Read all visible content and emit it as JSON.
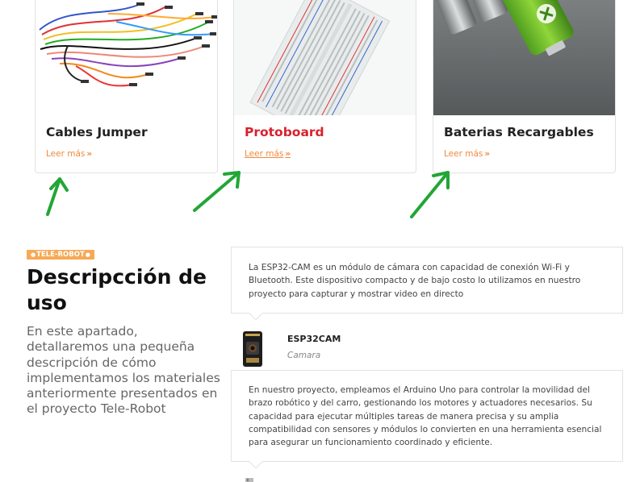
{
  "cards": [
    {
      "title": "Cables Jumper",
      "link": "Leer más",
      "chevron": "»",
      "image": "jumper-wires-image"
    },
    {
      "title": "Protoboard",
      "link": "Leer más",
      "chevron": "»",
      "image": "breadboard-image",
      "title_color": "#d8212d"
    },
    {
      "title": "Baterias Recargables",
      "link": "Leer más",
      "chevron": "»",
      "image": "rechargeable-batteries-image"
    }
  ],
  "annotations": {
    "arrow_color": "#22a636",
    "arrow_count": 3,
    "icon": "green-arrow-icon"
  },
  "section": {
    "badge": "TELE-ROBOT",
    "badge_color": "#f7a955",
    "title": "Descripcción de uso",
    "body": "En este apartado, detallaremos una pequeña descripción de cómo implementamos los materiales anteriormente presentados en el proyecto Tele-Robot"
  },
  "testimonials": [
    {
      "text": "La ESP32-CAM es un módulo de cámara con capacidad de conexión Wi-Fi y Bluetooth. Este dispositivo compacto y de bajo costo lo utilizamos en nuestro proyecto para capturar y mostrar video en directo",
      "name": "ESP32CAM",
      "role": "Camara"
    },
    {
      "text": "En nuestro proyecto, empleamos el Arduino Uno para controlar la movilidad del brazo robótico y del carro, gestionando los motores y actuadores necesarios. Su capacidad para ejecutar múltiples tareas de manera precisa y su amplia compatibilidad con sensores y módulos lo convierten en una herramienta esencial para asegurar un funcionamiento coordinado y eficiente."
    }
  ],
  "colors": {
    "accent_orange": "#ef8a3c",
    "accent_red": "#d8212d"
  }
}
